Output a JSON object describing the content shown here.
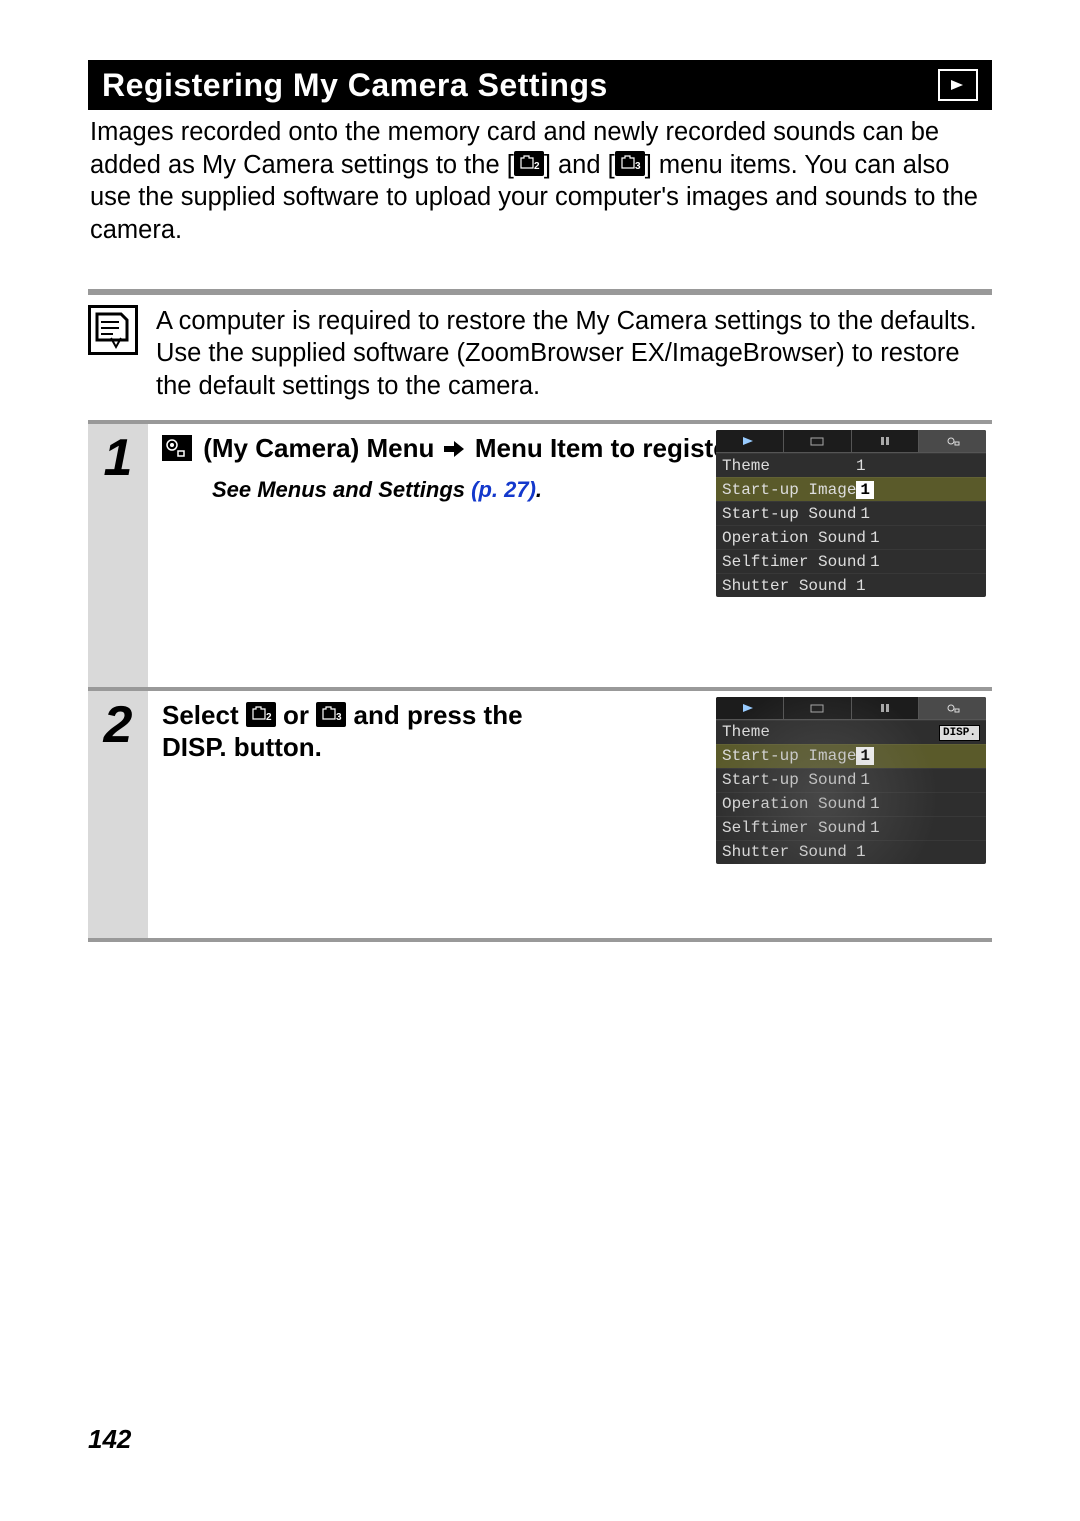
{
  "title": "Registering My Camera Settings",
  "intro": {
    "part1": "Images recorded onto the memory card and newly recorded sounds can be added as My Camera settings to the [",
    "part2": "] and [",
    "part3": "] menu items. You can also use the supplied software to upload your computer's images and sounds to the camera."
  },
  "tip": "A computer is required to restore the My Camera settings to the defaults. Use the supplied software (ZoomBrowser EX/ImageBrowser) to restore the default settings to the camera.",
  "steps": [
    {
      "num": "1",
      "heading_pre": "",
      "heading_icon": "my-camera",
      "heading_mid": " (My Camera) Menu ",
      "heading_arrow": true,
      "heading_post": " Menu Item to register.",
      "seeref_pre": "See Menus and Settings ",
      "seeref_page": "(p. 27)",
      "seeref_post": ".",
      "camshot": {
        "rows": [
          {
            "label": "Theme",
            "value": "1",
            "hl": false
          },
          {
            "label": "Start-up Image",
            "value": "1",
            "hl": true
          },
          {
            "label": "Start-up Sound",
            "value": "1",
            "hl": false
          },
          {
            "label": "Operation Sound",
            "value": "1",
            "hl": false
          },
          {
            "label": "Selftimer Sound",
            "value": "1",
            "hl": false
          },
          {
            "label": "Shutter Sound",
            "value": "1",
            "hl": false
          }
        ],
        "show_disp": false
      }
    },
    {
      "num": "2",
      "heading_pre": "Select ",
      "heading_icons_between": true,
      "heading_mid": " or ",
      "heading_post2": " and press the ",
      "heading_disp": "DISP.",
      "heading_tail": " button.",
      "camshot": {
        "rows": [
          {
            "label": "Theme",
            "value": "",
            "hl": false
          },
          {
            "label": "Start-up Image",
            "value": "1",
            "hl": true
          },
          {
            "label": "Start-up Sound",
            "value": "1",
            "hl": false
          },
          {
            "label": "Operation Sound",
            "value": "1",
            "hl": false
          },
          {
            "label": "Selftimer Sound",
            "value": "1",
            "hl": false
          },
          {
            "label": "Shutter Sound",
            "value": "1",
            "hl": false
          }
        ],
        "show_disp": true,
        "disp_label": "DISP."
      }
    }
  ],
  "page_number": "142"
}
